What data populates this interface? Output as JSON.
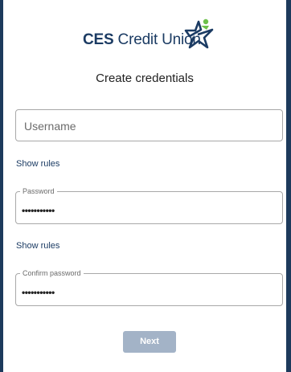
{
  "logo": {
    "brand_bold": "CES",
    "brand_rest": " Credit Union",
    "icon": "star-figure-icon"
  },
  "title": "Create credentials",
  "username": {
    "placeholder": "Username",
    "value": ""
  },
  "password": {
    "label": "Password",
    "value": "•••••••••••",
    "rules_link": "Show rules"
  },
  "confirm_password": {
    "label": "Confirm password",
    "value": "•••••••••••"
  },
  "username_rules_link": "Show rules",
  "next_button": "Next",
  "colors": {
    "brand_navy": "#1b3b63",
    "brand_green": "#6cc04a",
    "button_disabled": "#a3b3c7",
    "frame": "#1d3a5c"
  }
}
